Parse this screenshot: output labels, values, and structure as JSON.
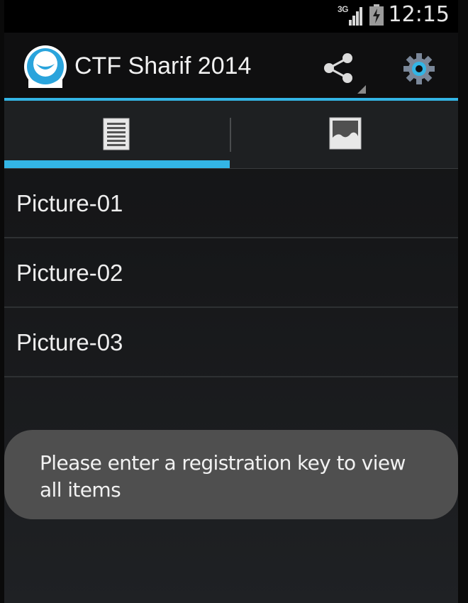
{
  "status_bar": {
    "network": "3G",
    "time": "12:15",
    "signal_icon": "signal-icon",
    "battery_icon": "battery-icon"
  },
  "action_bar": {
    "title": "CTF Sharif 2014",
    "logo_icon": "app-logo-icon",
    "share_icon": "share-icon",
    "settings_icon": "gear-icon",
    "accent_color": "#33b5e5"
  },
  "tabs": [
    {
      "icon": "list-icon",
      "selected": true
    },
    {
      "icon": "image-icon",
      "selected": false
    }
  ],
  "list": {
    "items": [
      {
        "label": "Picture-01"
      },
      {
        "label": "Picture-02"
      },
      {
        "label": "Picture-03"
      }
    ]
  },
  "toast": {
    "message": "Please enter a registration key to view all items"
  }
}
